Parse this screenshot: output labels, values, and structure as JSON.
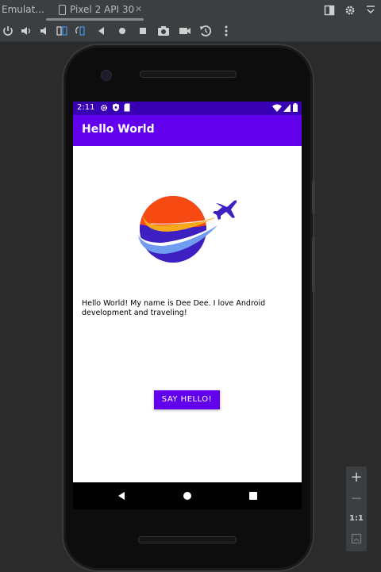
{
  "ide": {
    "tabs": [
      {
        "label": "Emulat..."
      },
      {
        "label": "Pixel 2 API 30",
        "close": "✕"
      }
    ],
    "toolbar_icons": [
      "power-icon",
      "volume-up-icon",
      "volume-down-icon",
      "rotate-left-icon",
      "rotate-right-icon",
      "back-icon",
      "home-icon",
      "overview-icon",
      "screenshot-icon",
      "screen-record-icon",
      "snapshot-icon",
      "more-icon"
    ]
  },
  "status_bar": {
    "time": "2:11"
  },
  "app": {
    "title": "Hello World",
    "body_text": "Hello World! My name is Dee Dee. I love Android development and traveling!",
    "button_label": "SAY HELLO!"
  },
  "zoom": {
    "plus": "+",
    "minus": "−",
    "one_to_one": "1:1"
  },
  "colors": {
    "status_bar": "#3700b3",
    "app_bar": "#6200ee",
    "button": "#6200ee",
    "ide_bg": "#2b2b2b",
    "ide_panel": "#3c3f41"
  }
}
